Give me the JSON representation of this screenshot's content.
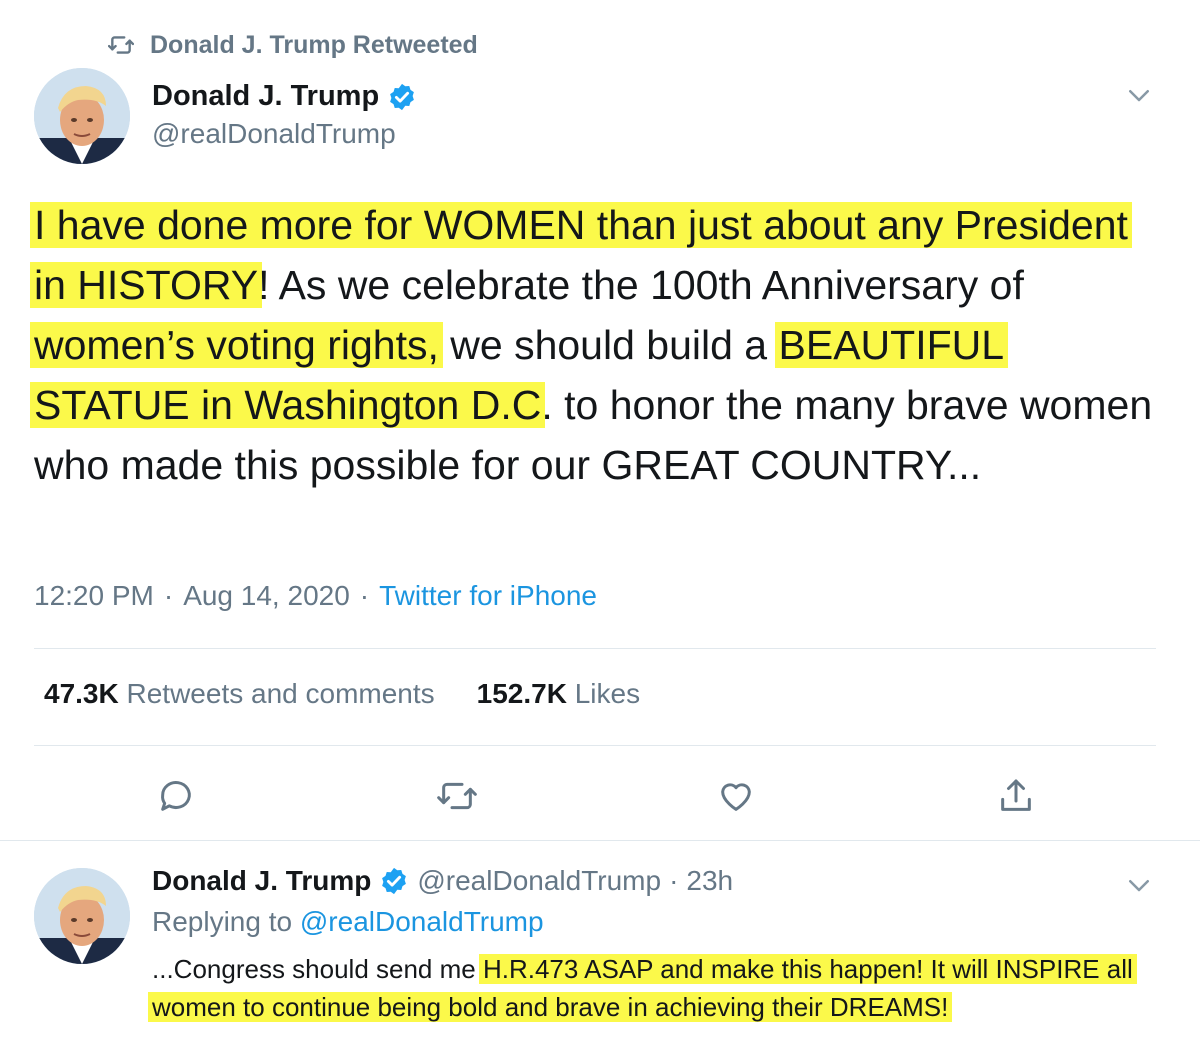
{
  "retweet_header": {
    "text": "Donald J. Trump Retweeted",
    "icon": "retweet-icon"
  },
  "main_tweet": {
    "author_name": "Donald J. Trump",
    "author_handle": "@realDonaldTrump",
    "text_segments": [
      {
        "text": "I have done more for WOMEN than just about any President in HISTORY",
        "highlight": true
      },
      {
        "text": "! As we celebrate the 100th Anniversary of ",
        "highlight": false
      },
      {
        "text": "women’s voting rights,",
        "highlight": true
      },
      {
        "text": " we should build a ",
        "highlight": false
      },
      {
        "text": "BEAUTIFUL STATUE in Washington D.C",
        "highlight": true
      },
      {
        "text": ". to honor the many brave women who made this possible for our GREAT COUNTRY...",
        "highlight": false
      }
    ],
    "time": "12:20 PM",
    "date": "Aug 14, 2020",
    "separator": "·",
    "source": "Twitter for iPhone",
    "retweets_count": "47.3K",
    "retweets_label": "Retweets and comments",
    "likes_count": "152.7K",
    "likes_label": "Likes"
  },
  "reply_tweet": {
    "author_name": "Donald J. Trump",
    "author_handle": "@realDonaldTrump",
    "separator": "·",
    "age": "23h",
    "replying_label": "Replying to",
    "replying_handle": "@realDonaldTrump",
    "text_segments": [
      {
        "text": "...Congress should send me ",
        "highlight": false
      },
      {
        "text": "H.R.473 ASAP and make this happen! It will INSPIRE all women to continue being bold and brave in achieving their DREAMS!",
        "highlight": true
      }
    ]
  },
  "colors": {
    "highlight": "#fbf94a",
    "link": "#1b95e0",
    "muted": "#657786",
    "verified": "#1da1f2"
  }
}
